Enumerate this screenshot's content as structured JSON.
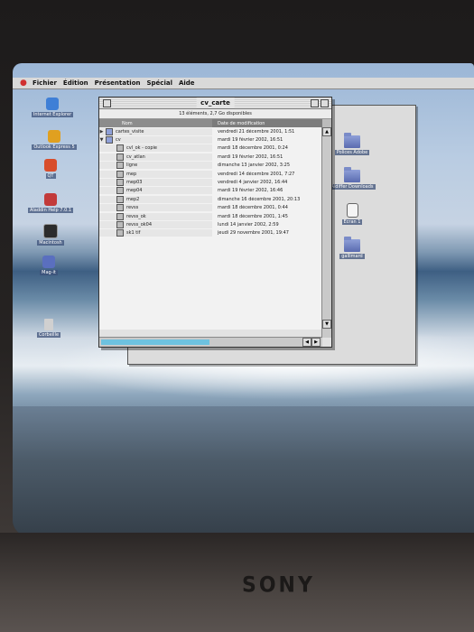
{
  "menubar": {
    "items": [
      "Fichier",
      "Édition",
      "Présentation",
      "Spécial",
      "Aide"
    ]
  },
  "desktop_left_icons": [
    {
      "label": "Internet Explorer",
      "icon": "internet-explorer-icon"
    },
    {
      "label": "Outlook Express 5",
      "icon": "outlook-express-icon"
    },
    {
      "label": "QT",
      "icon": "quicktime-icon"
    },
    {
      "label": "Aladdin Help 7.0.1",
      "icon": "help-icon"
    },
    {
      "label": "Macintosh",
      "icon": "hard-disk-icon"
    },
    {
      "label": "Mag-it",
      "icon": "disk-icon"
    },
    {
      "label": "Corbeille",
      "icon": "trash-icon"
    }
  ],
  "desktop_right_icons": [
    {
      "label": "Polices Adobe",
      "icon": "folder-icon"
    },
    {
      "label": "Aldiffer Downloads",
      "icon": "folder-icon"
    },
    {
      "label": "Écran 1",
      "icon": "document-icon"
    },
    {
      "label": "gallimard",
      "icon": "folder-icon"
    }
  ],
  "window": {
    "title": "cv_carte",
    "info": "13 éléments, 2,7 Go disponibles",
    "columns": {
      "name": "Nom",
      "date": "Date de modification"
    },
    "rows": [
      {
        "name": "cartes_visite",
        "date": "vendredi 21 décembre 2001, 1:51",
        "type": "folder",
        "expanded": false
      },
      {
        "name": "cv",
        "date": "mardi 19 février 2002, 16:51",
        "type": "folder",
        "expanded": true
      },
      {
        "name": "cvl_ok - copie",
        "date": "mardi 18 décembre 2001, 0:24",
        "type": "file"
      },
      {
        "name": "cv_atlan",
        "date": "mardi 19 février 2002, 16:51",
        "type": "file"
      },
      {
        "name": "ligne",
        "date": "dimanche 13 janvier 2002, 3:25",
        "type": "file"
      },
      {
        "name": "mep",
        "date": "vendredi 14 décembre 2001, 7:27",
        "type": "file"
      },
      {
        "name": "mep03",
        "date": "vendredi 4 janvier 2002, 16:44",
        "type": "file"
      },
      {
        "name": "mep04",
        "date": "mardi 19 février 2002, 16:46",
        "type": "file"
      },
      {
        "name": "mep2",
        "date": "dimanche 16 décembre 2001, 20:13",
        "type": "file"
      },
      {
        "name": "revss",
        "date": "mardi 18 décembre 2001, 0:44",
        "type": "file"
      },
      {
        "name": "revss_ok",
        "date": "mardi 18 décembre 2001, 1:45",
        "type": "file"
      },
      {
        "name": "revss_ok04",
        "date": "lundi 14 janvier 2002, 2:59",
        "type": "file"
      },
      {
        "name": "sk1 tif",
        "date": "jeudi 29 novembre 2001, 19:47",
        "type": "file"
      }
    ]
  },
  "monitor": {
    "brand": "SONY"
  },
  "colors": {
    "scroll_thumb": "#6ec2e0",
    "menubar": "#d9d9d9"
  }
}
